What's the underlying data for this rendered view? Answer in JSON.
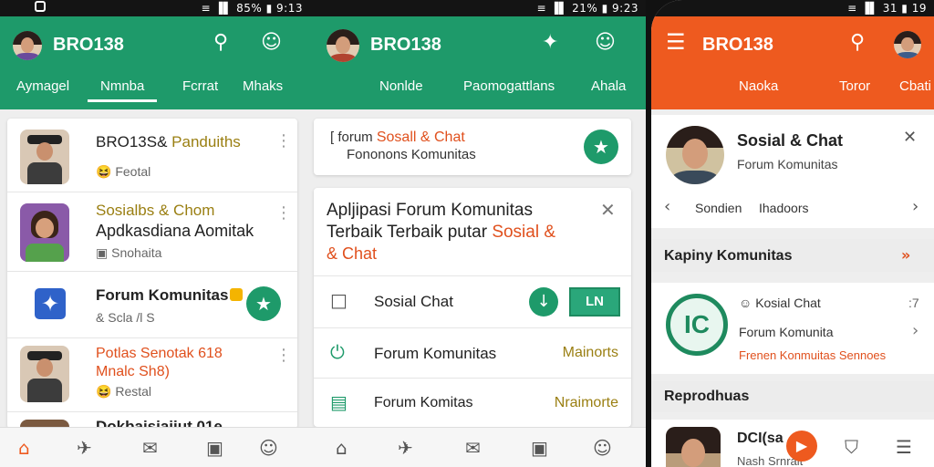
{
  "status_left": "",
  "screen1": {
    "status_right": "≡ ▐▌ 85% ▮ 9:13",
    "app_title": "BRO138",
    "tabs": [
      "Aymagel",
      "Nmnba",
      "Fcrrat",
      "Mhaks"
    ],
    "rows": [
      {
        "title": "BRO13S&",
        "title_accent": "Panduiths",
        "sub": "Feotal",
        "sub_icon": "😆"
      },
      {
        "title_accent": "Sosialbs & Chom",
        "title": "Apdkasdiana Aomitak",
        "sub": "Snohaita",
        "sub_icon": "▣"
      },
      {
        "title": "Forum Komunitas",
        "sub": "& Scla /l S"
      },
      {
        "title_accent": "Potlas Senotak 618",
        "title_accent2": "Mnalc Sh8)",
        "sub": "Restal",
        "sub_icon": "😆"
      },
      {
        "title": "Dokbaisiaiiut 01e"
      }
    ],
    "bottom_nav": [
      "home-icon",
      "send-icon",
      "mail-icon",
      "bookmark-icon",
      "profile-icon"
    ]
  },
  "screen2": {
    "status_right": "≡ ▐▌ 21% ▮ 9:23",
    "app_title": "BRO138",
    "tabs": [
      "Nonlde",
      "Paomogattlans",
      "Ahala"
    ],
    "search_card": {
      "line1_prefix": "[  forum",
      "line1_accent": "Sosall & Chat",
      "line2": "Fononons Komunitas"
    },
    "dialog": {
      "title_line1": "Apljipasi Forum Komunitas",
      "title_line2": "Terbaik Terbaik putar",
      "title_accent": "Sosial &",
      "title_line3": "& Chat"
    },
    "list": [
      {
        "label": "Sosial Chat",
        "badge": "LN"
      },
      {
        "label": "Forum Komunitas",
        "right": "Mainorts"
      },
      {
        "label": "Forum Komitas",
        "right": "Nraimorte"
      }
    ],
    "bottom_nav": [
      "home-icon",
      "send-icon",
      "mail-icon",
      "chat-icon",
      "profile-icon"
    ]
  },
  "screen3": {
    "status_right": "≡ ▐▌ 31 ▮ 19",
    "app_title": "BRO138",
    "tabs": [
      "Naoka",
      "Toror",
      "Cbati"
    ],
    "profile": {
      "name": "Sosial & Chat",
      "sub": "Forum Komunitas",
      "nav_left": "Sondien",
      "nav_right": "Ihadoors"
    },
    "section1": "Kapiny Komunitas",
    "community": {
      "line1": "Kosial Chat",
      "line1_right": ":7",
      "line2": "Forum Komunita",
      "line3": "Frenen Konmuitas Sennoes"
    },
    "section2": "Reprodhuas",
    "last_row": {
      "title": "DCI(sa",
      "sub": "Nash Srnrait"
    },
    "bottom_nav": [
      "play-icon",
      "shield-icon",
      "menu-icon"
    ]
  },
  "colors": {
    "green": "#1e9a6a",
    "orange": "#ee5a1f",
    "olive": "#9a7f12"
  }
}
